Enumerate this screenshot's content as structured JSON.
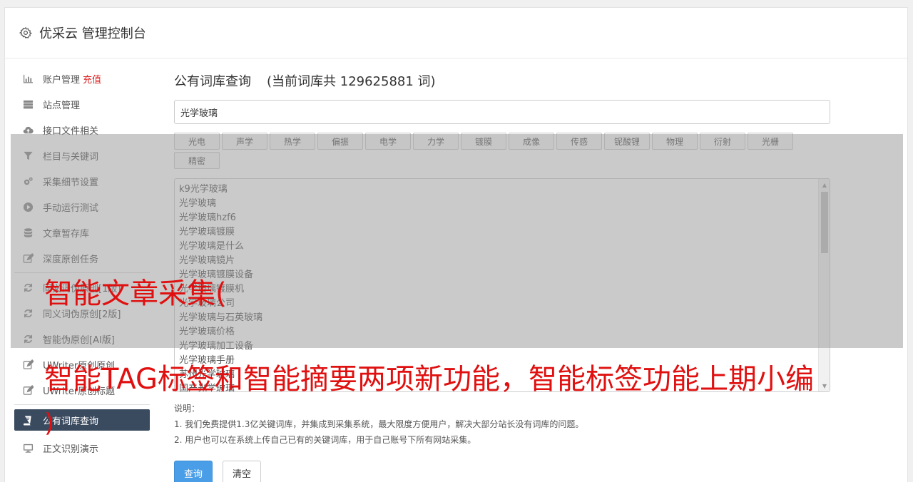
{
  "header": {
    "title": "优采云 管理控制台",
    "icon": "gear-icon"
  },
  "sidebar": {
    "items": [
      {
        "label": "账户管理",
        "extra": "充值",
        "icon": "bar-chart-icon"
      },
      {
        "label": "站点管理",
        "icon": "server-icon"
      },
      {
        "label": "接口文件相关",
        "icon": "cloud-upload-icon"
      },
      {
        "label": "栏目与关键词",
        "icon": "filter-icon"
      },
      {
        "label": "采集细节设置",
        "icon": "gears-icon"
      },
      {
        "label": "手动运行测试",
        "icon": "play-icon"
      },
      {
        "label": "文章暂存库",
        "icon": "database-icon"
      },
      {
        "label": "深度原创任务",
        "icon": "edit-icon"
      },
      {
        "label": "同义词伪原创[1版]",
        "icon": "refresh-icon"
      },
      {
        "label": "同义词伪原创[2版]",
        "icon": "refresh-icon"
      },
      {
        "label": "智能伪原创[AI版]",
        "icon": "refresh-icon"
      },
      {
        "label": "UWriter原创原创",
        "icon": "edit-icon"
      },
      {
        "label": "UWriter原创标题",
        "icon": "edit-icon"
      },
      {
        "label": "公有词库查询",
        "icon": "book-icon",
        "active": true
      },
      {
        "label": "正文识别演示",
        "icon": "monitor-icon"
      }
    ]
  },
  "main": {
    "title": "公有词库查询",
    "count": "(当前词库共 129625881 词)",
    "search_value": "光学玻璃",
    "tags": [
      "光电",
      "声学",
      "热学",
      "偏振",
      "电学",
      "力学",
      "镀膜",
      "成像",
      "传感",
      "铌酸锂",
      "物理",
      "衍射",
      "光栅",
      "精密"
    ],
    "results": [
      "k9光学玻璃",
      "光学玻璃",
      "光学玻璃hzf6",
      "光学玻璃镀膜",
      "光学玻璃是什么",
      "光学玻璃镜片",
      "光学玻璃镀膜设备",
      "光学玻璃镀膜机",
      "光学玻璃公司",
      "光学玻璃与石英玻璃",
      "光学玻璃价格",
      "光学玻璃加工设备",
      "光学玻璃手册",
      "苏州光学玻璃",
      "国产光学玻璃"
    ],
    "notes": {
      "heading": "说明：",
      "line1": "1. 我们免费提供1.3亿关键词库，并集成到采集系统，最大限度方便用户，解决大部分站长没有词库的问题。",
      "line2": "2. 用户也可以在系统上传自己已有的关键词库，用于自己账号下所有网站采集。"
    },
    "query_button": "查询",
    "clear_button": "清空"
  },
  "captions": {
    "line1": "智能文章采集(",
    "line2": "智能TAG标签和智能摘要两项新功能，智能标签功能上期小编",
    "line3": ")"
  },
  "colors": {
    "accent": "#4a9ee8",
    "active_nav": "#3a4a5f",
    "caption": "#e01010",
    "recharge": "#e02020"
  }
}
